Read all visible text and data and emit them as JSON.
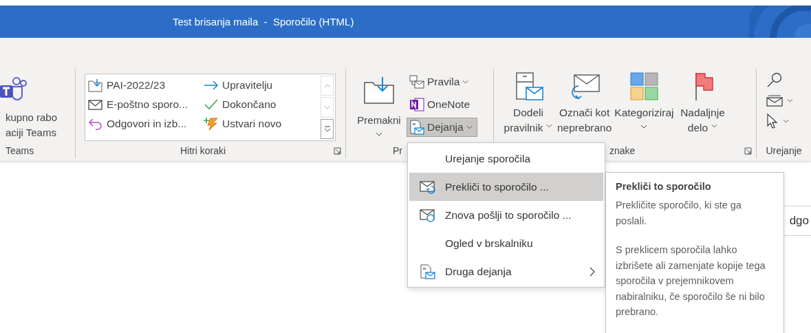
{
  "window": {
    "title": "Test brisanja maila  -  Sporočilo (HTML)"
  },
  "ribbon": {
    "groups": [
      {
        "kind": "teams",
        "label": "Teams",
        "button": {
          "lines": [
            "kupno rabo",
            "aciji Teams"
          ]
        }
      },
      {
        "kind": "quick_steps",
        "label": "Hitri koraki",
        "launcher": true,
        "steps": [
          {
            "kind": "move",
            "label": "PAI-2022/23"
          },
          {
            "kind": "email",
            "label": "E-poštno sporo..."
          },
          {
            "kind": "reply",
            "label": "Odgovori in izb..."
          },
          {
            "kind": "forward",
            "label": "Upravitelju"
          },
          {
            "kind": "done",
            "label": "Dokončano"
          },
          {
            "kind": "create",
            "label": "Ustvari novo"
          }
        ]
      },
      {
        "kind": "move",
        "label": "Pr",
        "large": {
          "lines": [
            "Premakni"
          ],
          "dropdown": true
        },
        "small": [
          {
            "kind": "rules",
            "label": "Pravila",
            "dropdown": true,
            "pressed": false
          },
          {
            "kind": "onenote",
            "label": "OneNote",
            "dropdown": false,
            "pressed": false
          },
          {
            "kind": "actions",
            "label": "Dejanja",
            "dropdown": true,
            "pressed": true
          }
        ]
      },
      {
        "kind": "tags",
        "label": "znake",
        "launcher": true,
        "buttons": [
          {
            "kind": "policy",
            "lines": [
              "Dodeli",
              "pravilnik"
            ],
            "dropdown": true
          },
          {
            "kind": "unread",
            "lines": [
              "Označi kot",
              "neprebrano"
            ],
            "dropdown": false
          },
          {
            "kind": "categorize",
            "lines": [
              "Kategoriziraj"
            ],
            "dropdown": true
          },
          {
            "kind": "flag",
            "lines": [
              "Nadaljnje",
              "delo"
            ],
            "dropdown": true
          }
        ]
      },
      {
        "kind": "editing",
        "label": "Urejanje"
      }
    ]
  },
  "actions_menu": {
    "items": [
      {
        "kind": "plain",
        "label": "Urejanje sporočila",
        "selected": false,
        "submenu": false
      },
      {
        "kind": "recall",
        "label": "Prekliči to sporočilo ...",
        "selected": true,
        "submenu": false
      },
      {
        "kind": "resend",
        "label": "Znova pošlji to sporočilo ...",
        "selected": false,
        "submenu": false
      },
      {
        "kind": "plain",
        "label": "Ogled v brskalniku",
        "selected": false,
        "submenu": false
      },
      {
        "kind": "other",
        "label": "Druga dejanja",
        "selected": false,
        "submenu": true
      }
    ]
  },
  "tooltip": {
    "title": "Prekliči to sporočilo",
    "paragraphs": [
      "Prekličite sporočilo, ki ste ga poslali.",
      "S preklicem sporočila lahko izbrišete ali zamenjate kopije tega sporočila v prejemnikovem nabiralniku, če sporočilo še ni bilo prebrano."
    ]
  },
  "reading_pane": {
    "partial_text": "dgo"
  }
}
